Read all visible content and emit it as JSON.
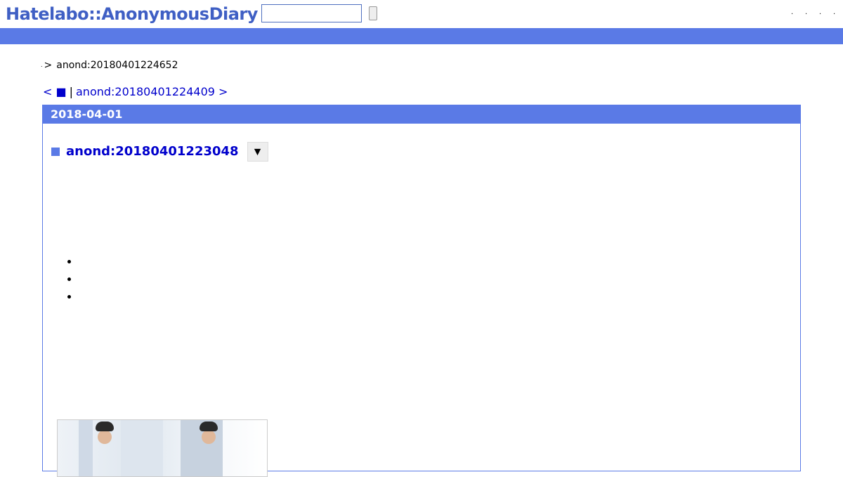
{
  "header": {
    "logo": "Hatelabo::AnonymousDiary",
    "search": {
      "value": "",
      "placeholder": ""
    },
    "links": [
      ".",
      ".",
      ".",
      "."
    ]
  },
  "breadcrumb": {
    "home": ".",
    "separator": ">",
    "current": "anond:20180401224652"
  },
  "pager": {
    "prev_label": "< ■",
    "divider": "|",
    "next_label": "anond:20180401224409 >"
  },
  "day": {
    "date": "2018-04-01",
    "entry": {
      "title": "anond:20180401223048",
      "menu_label": "▼"
    },
    "bullets": [
      "",
      "",
      ""
    ]
  },
  "colors": {
    "brand": "#3f5fc4",
    "band": "#5a7ae6",
    "link": "#0000cc"
  },
  "icons": {
    "entry_marker": "square-icon",
    "menu": "caret-down-icon"
  }
}
